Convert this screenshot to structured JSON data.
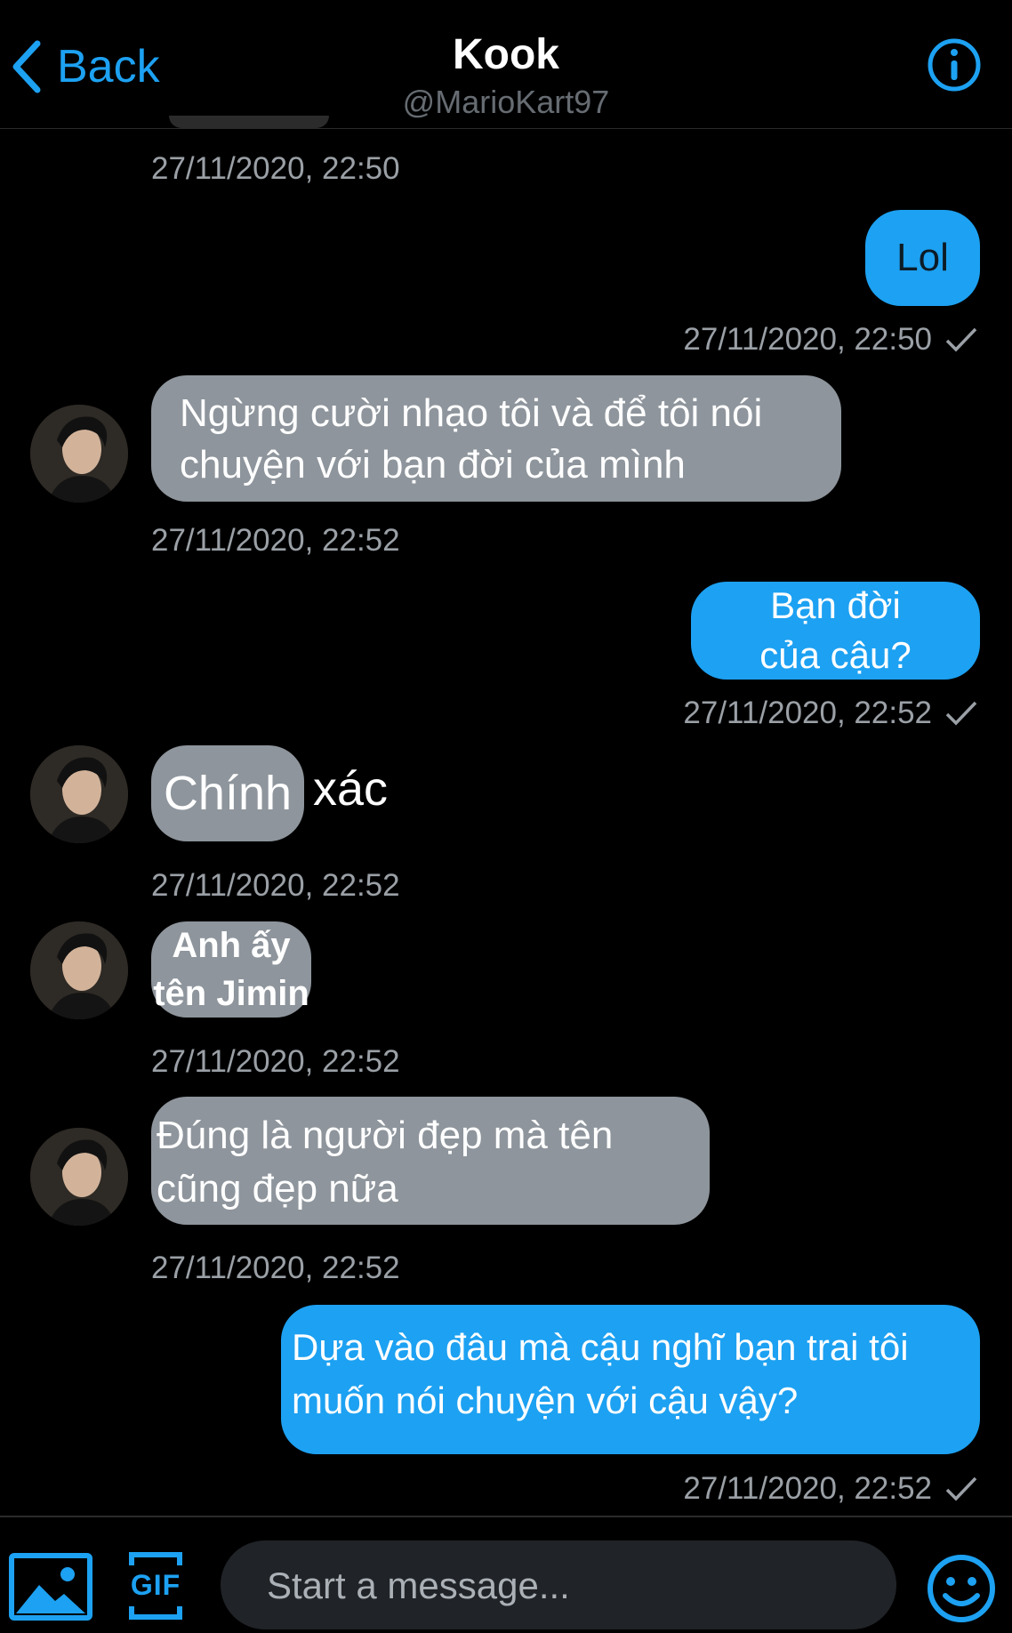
{
  "header": {
    "back_label": "Back",
    "title": "Kook",
    "handle": "@MarioKart97"
  },
  "messages": [
    {
      "direction": "in",
      "timestamp": "27/11/2020, 22:50"
    },
    {
      "direction": "out",
      "text": "Lol",
      "timestamp": "27/11/2020, 22:50"
    },
    {
      "direction": "in",
      "lines": [
        "Ngừng cười nhạo tôi và để tôi nói",
        "chuyện với bạn đời của mình"
      ],
      "timestamp": "27/11/2020, 22:52"
    },
    {
      "direction": "out",
      "lines": [
        "Bạn đời",
        "của cậu?"
      ],
      "timestamp": "27/11/2020, 22:52"
    },
    {
      "direction": "in",
      "text_a": "Chính",
      "text_b": "xác",
      "timestamp": "27/11/2020, 22:52"
    },
    {
      "direction": "in",
      "lines": [
        "Anh ấy",
        "tên Jimin"
      ],
      "timestamp": "27/11/2020, 22:52"
    },
    {
      "direction": "in",
      "lines": [
        "Đúng là người đẹp mà tên",
        "cũng đẹp nữa"
      ],
      "timestamp": "27/11/2020, 22:52"
    },
    {
      "direction": "out",
      "lines": [
        "Dựa vào đâu mà cậu nghĩ bạn trai tôi",
        "muốn nói chuyện với cậu vậy?"
      ],
      "timestamp": "27/11/2020, 22:52"
    }
  ],
  "composer": {
    "placeholder": "Start a message...",
    "gif_label": "GIF"
  },
  "colors": {
    "accent": "#1da1f2",
    "incoming_bubble": "#8e959c",
    "timestamp": "#9aa0a6"
  },
  "icons": [
    "chevron-left-icon",
    "info-icon",
    "checkmark-icon",
    "image-icon",
    "gif-icon",
    "emoji-icon"
  ]
}
